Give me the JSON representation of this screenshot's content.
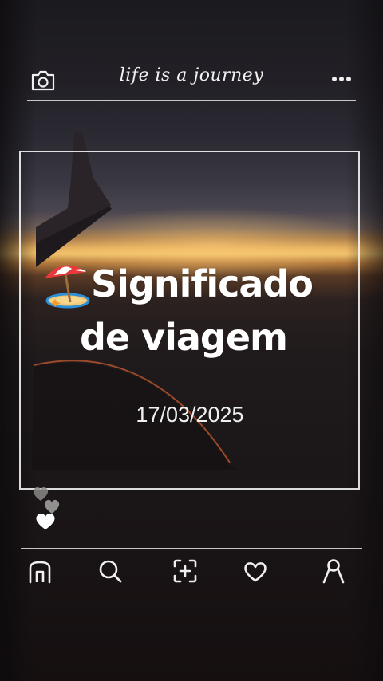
{
  "header": {
    "brand": "life is a journey",
    "camera_icon": "camera-icon",
    "more_icon": "more-horizontal-icon"
  },
  "post": {
    "emoji": "beach-umbrella-icon",
    "title_line1": "Significado",
    "title_line2": "de viagem",
    "date": "17/03/2025"
  },
  "reactions": {
    "icon": "hearts-icon"
  },
  "nav": {
    "items": [
      {
        "name": "home",
        "icon": "home-icon"
      },
      {
        "name": "search",
        "icon": "search-icon"
      },
      {
        "name": "add",
        "icon": "add-post-icon"
      },
      {
        "name": "likes",
        "icon": "heart-icon"
      },
      {
        "name": "profile",
        "icon": "profile-icon"
      }
    ]
  },
  "colors": {
    "text": "#ffffff",
    "sunset": "#f1c26c",
    "background": "#151113"
  }
}
